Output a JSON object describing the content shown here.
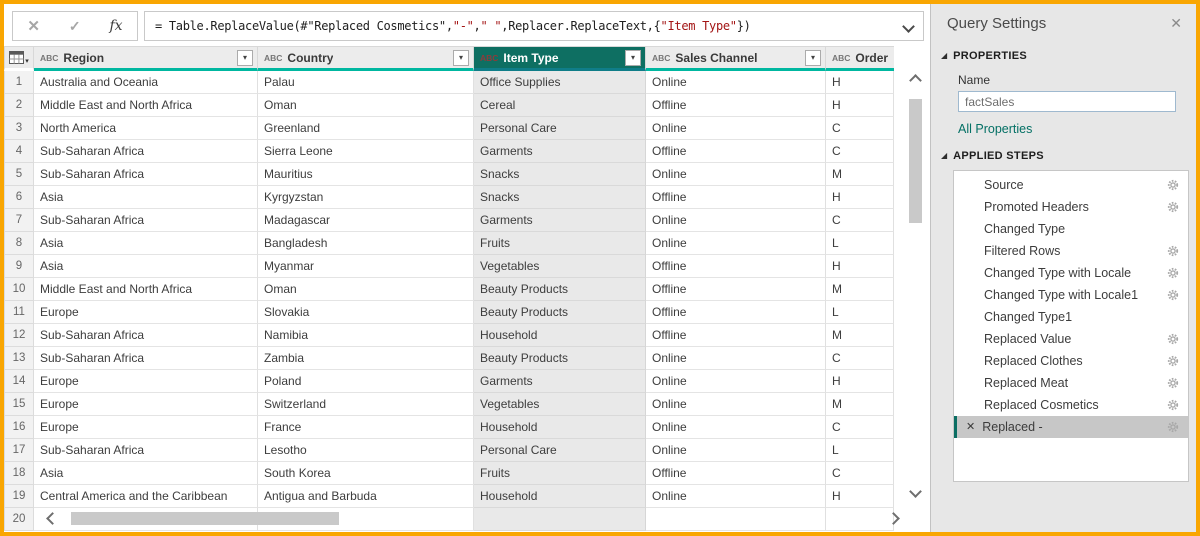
{
  "colors": {
    "frame_accent": "#F9A602",
    "selected_header_teal": "#0E6F62",
    "quality_bar_teal": "#00B7A0",
    "link_teal": "#047065",
    "formula_string_red": "#A31515"
  },
  "formula_bar": {
    "cancel_icon": "✕",
    "check_icon": "✓",
    "fx_icon": "fx",
    "segments": [
      {
        "type": "code",
        "text": "= Table.ReplaceValue(#\"Replaced Cosmetics\","
      },
      {
        "type": "string",
        "text": "\"-\""
      },
      {
        "type": "code",
        "text": ","
      },
      {
        "type": "string",
        "text": "\" \""
      },
      {
        "type": "code",
        "text": ",Replacer.ReplaceText,{"
      },
      {
        "type": "string",
        "text": "\"Item Type\""
      },
      {
        "type": "code",
        "text": "})"
      }
    ]
  },
  "icons": {
    "filter_caret": "▾",
    "expander_triangle": "◢",
    "corner_caret": "▾"
  },
  "table": {
    "columns": [
      {
        "label": "Region",
        "type_icon": "ABC",
        "selected": false,
        "has_filter": true
      },
      {
        "label": "Country",
        "type_icon": "ABC",
        "selected": false,
        "has_filter": true
      },
      {
        "label": "Item Type",
        "type_icon": "ABC",
        "selected": true,
        "has_filter": true
      },
      {
        "label": "Sales Channel",
        "type_icon": "ABC",
        "selected": false,
        "has_filter": true
      },
      {
        "label": "Order Prior",
        "type_icon": "ABC",
        "selected": false,
        "has_filter": false
      }
    ],
    "rows": [
      {
        "num": "1",
        "cells": [
          "Australia and Oceania",
          "Palau",
          "Office Supplies",
          "Online",
          "H"
        ]
      },
      {
        "num": "2",
        "cells": [
          "Middle East and North Africa",
          "Oman",
          "Cereal",
          "Offline",
          "H"
        ]
      },
      {
        "num": "3",
        "cells": [
          "North America",
          "Greenland",
          "Personal Care",
          "Online",
          "C"
        ]
      },
      {
        "num": "4",
        "cells": [
          "Sub-Saharan Africa",
          "Sierra Leone",
          "Garments",
          "Offline",
          "C"
        ]
      },
      {
        "num": "5",
        "cells": [
          "Sub-Saharan Africa",
          "Mauritius",
          "Snacks",
          "Online",
          "M"
        ]
      },
      {
        "num": "6",
        "cells": [
          "Asia",
          "Kyrgyzstan",
          "Snacks",
          "Offline",
          "H"
        ]
      },
      {
        "num": "7",
        "cells": [
          "Sub-Saharan Africa",
          "Madagascar",
          "Garments",
          "Online",
          "C"
        ]
      },
      {
        "num": "8",
        "cells": [
          "Asia",
          "Bangladesh",
          "Fruits",
          "Online",
          "L"
        ]
      },
      {
        "num": "9",
        "cells": [
          "Asia",
          "Myanmar",
          "Vegetables",
          "Offline",
          "H"
        ]
      },
      {
        "num": "10",
        "cells": [
          "Middle East and North Africa",
          "Oman",
          "Beauty Products",
          "Offline",
          "M"
        ]
      },
      {
        "num": "11",
        "cells": [
          "Europe",
          "Slovakia",
          "Beauty Products",
          "Offline",
          "L"
        ]
      },
      {
        "num": "12",
        "cells": [
          "Sub-Saharan Africa",
          "Namibia",
          "Household",
          "Offline",
          "M"
        ]
      },
      {
        "num": "13",
        "cells": [
          "Sub-Saharan Africa",
          "Zambia",
          "Beauty Products",
          "Online",
          "C"
        ]
      },
      {
        "num": "14",
        "cells": [
          "Europe",
          "Poland",
          "Garments",
          "Online",
          "H"
        ]
      },
      {
        "num": "15",
        "cells": [
          "Europe",
          "Switzerland",
          "Vegetables",
          "Online",
          "M"
        ]
      },
      {
        "num": "16",
        "cells": [
          "Europe",
          "France",
          "Household",
          "Online",
          "C"
        ]
      },
      {
        "num": "17",
        "cells": [
          "Sub-Saharan Africa",
          "Lesotho",
          "Personal Care",
          "Online",
          "L"
        ]
      },
      {
        "num": "18",
        "cells": [
          "Asia",
          "South Korea",
          "Fruits",
          "Offline",
          "C"
        ]
      },
      {
        "num": "19",
        "cells": [
          "Central America and the Caribbean",
          "Antigua and Barbuda",
          "Household",
          "Online",
          "H"
        ]
      },
      {
        "num": "20",
        "cells": [
          "",
          "",
          "",
          "",
          ""
        ]
      }
    ]
  },
  "query_settings": {
    "title": "Query Settings",
    "close_icon": "✕",
    "properties": {
      "heading": "PROPERTIES",
      "name_label": "Name",
      "name_value": "factSales",
      "all_properties_label": "All Properties"
    },
    "applied_steps": {
      "heading": "APPLIED STEPS",
      "delete_icon": "✕",
      "steps": [
        {
          "label": "Source",
          "gear": true,
          "selected": false
        },
        {
          "label": "Promoted Headers",
          "gear": true,
          "selected": false
        },
        {
          "label": "Changed Type",
          "gear": false,
          "selected": false
        },
        {
          "label": "Filtered Rows",
          "gear": true,
          "selected": false
        },
        {
          "label": "Changed Type with Locale",
          "gear": true,
          "selected": false
        },
        {
          "label": "Changed Type with Locale1",
          "gear": true,
          "selected": false
        },
        {
          "label": "Changed Type1",
          "gear": false,
          "selected": false
        },
        {
          "label": "Replaced Value",
          "gear": true,
          "selected": false
        },
        {
          "label": "Replaced Clothes",
          "gear": true,
          "selected": false
        },
        {
          "label": "Replaced Meat",
          "gear": true,
          "selected": false
        },
        {
          "label": "Replaced Cosmetics",
          "gear": true,
          "selected": false
        },
        {
          "label": "Replaced -",
          "gear": true,
          "selected": true
        }
      ]
    }
  }
}
